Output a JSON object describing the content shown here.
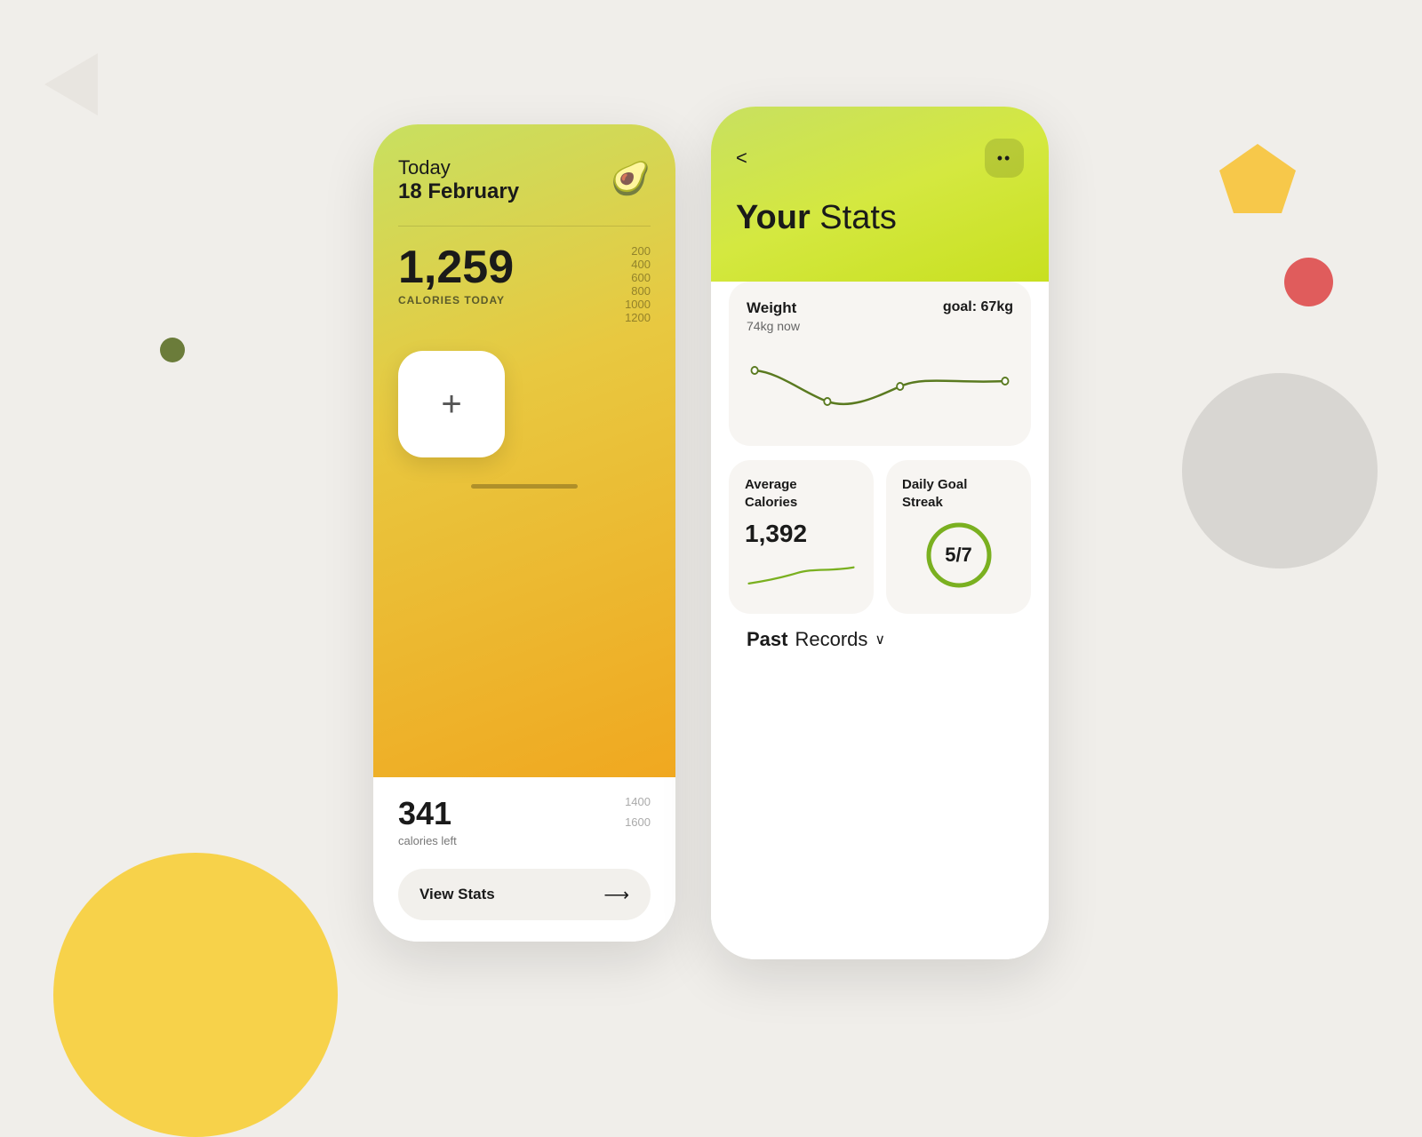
{
  "background": {
    "color": "#f0eeea"
  },
  "phone_left": {
    "today_label": "Today",
    "date_label": "18 February",
    "avocado_emoji": "🥑",
    "calories_value": "1,259",
    "calories_label": "CALORIES TODAY",
    "scale_labels": [
      "200",
      "400",
      "600",
      "800",
      "1000",
      "1200"
    ],
    "add_button_label": "+",
    "calories_left_value": "341",
    "calories_left_label": "calories left",
    "scale_right_labels": [
      "1400",
      "1600"
    ],
    "view_stats_label": "View Stats",
    "arrow": "→"
  },
  "phone_right": {
    "back_label": "<",
    "more_label": "••",
    "title_bold": "Your",
    "title_normal": " Stats",
    "weight_card": {
      "title": "Weight",
      "now": "74kg now",
      "goal_label": "goal:",
      "goal_value": "67kg"
    },
    "avg_calories_card": {
      "title": "Average\nCalories",
      "value": "1,392"
    },
    "daily_goal_card": {
      "title": "Daily Goal\nStreak",
      "value": "5/7"
    },
    "past_records_bold": "Past",
    "past_records_normal": " Records",
    "chevron": "∨"
  }
}
